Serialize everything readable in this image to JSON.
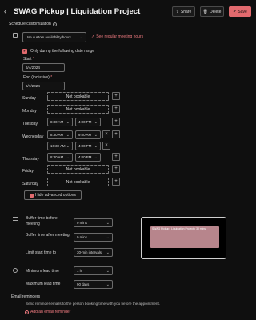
{
  "header": {
    "title": "SWAG Pickup | Liquidation Project",
    "share_label": "Share",
    "delete_label": "Delete",
    "save_label": "Save"
  },
  "schedule": {
    "section_label": "Schedule customization",
    "availability_select": "Use custom availability hours",
    "see_hours_link": "See regular meeting hours",
    "date_range_label": "Only during the following date range",
    "start_label": "Start",
    "start_value": "6/4/2024",
    "end_label": "End (inclusive)",
    "end_value": "6/7/2024",
    "required_mark": "*"
  },
  "days": {
    "sunday": "Sunday",
    "monday": "Monday",
    "tuesday": "Tuesday",
    "wednesday": "Wednesday",
    "thursday": "Thursday",
    "friday": "Friday",
    "saturday": "Saturday",
    "not_bookable": "Not bookable",
    "tuesday_from": "8:30 AM",
    "tuesday_to": "4:00 PM",
    "wednesday_from_1": "8:30 AM",
    "wednesday_to_1": "9:00 AM",
    "wednesday_from_2": "10:30 AM",
    "wednesday_to_2": "4:00 PM",
    "thursday_from": "8:30 AM",
    "thursday_to": "4:00 PM"
  },
  "advanced_options": {
    "hide_label": "Hide advanced options"
  },
  "buffers": {
    "before_label": "Buffer time before meeting",
    "before_value": "0 mins",
    "after_label": "Buffer time after meeting",
    "after_value": "0 mins",
    "limit_label": "Limit start time to",
    "limit_value": "30-min intervals"
  },
  "preview": {
    "event_text": "SWAG Pickup | Liquidation Project • 30 mins"
  },
  "lead_time": {
    "min_label": "Minimum lead time",
    "min_value": "1 hr",
    "max_label": "Maximum lead time",
    "max_value": "90 days"
  },
  "email": {
    "section_label": "Email reminders",
    "description": "Send reminder emails to the person booking time with you before the appointment.",
    "add_link": "Add an email reminder"
  },
  "colors": {
    "accent": "#e26a6e",
    "background": "#0f0f0f",
    "preview_event": "#b7858c"
  }
}
